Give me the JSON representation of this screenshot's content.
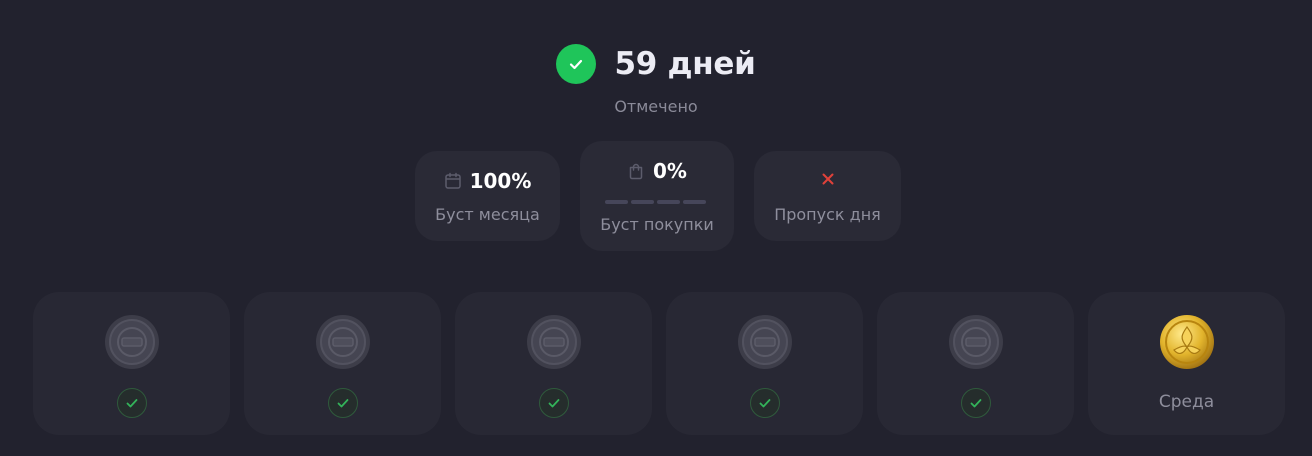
{
  "streak": {
    "days_label": "59 дней",
    "status_label": "Отмечено",
    "icon": "check-circle-icon"
  },
  "boosts": {
    "month": {
      "value": "100%",
      "label": "Буст месяца",
      "icon": "calendar-icon"
    },
    "purchase": {
      "value": "0%",
      "label": "Буст покупки",
      "icon": "shopping-bag-icon",
      "progress_segments": 4,
      "progress_filled": 0
    },
    "skip": {
      "label": "Пропуск дня",
      "icon": "x-icon"
    }
  },
  "days": [
    {
      "state": "claimed",
      "icon": "coin-icon"
    },
    {
      "state": "claimed",
      "icon": "coin-icon"
    },
    {
      "state": "claimed",
      "icon": "coin-icon"
    },
    {
      "state": "claimed",
      "icon": "coin-icon"
    },
    {
      "state": "claimed",
      "icon": "coin-icon"
    },
    {
      "state": "upcoming",
      "label": "Среда",
      "icon": "gold-coin-icon"
    }
  ],
  "colors": {
    "background": "#22222e",
    "card": "#282834",
    "accent_green": "#1fc55a",
    "muted_text": "#8e8e9c",
    "skip_red": "#e0413a",
    "gold": "#e2b42c"
  }
}
